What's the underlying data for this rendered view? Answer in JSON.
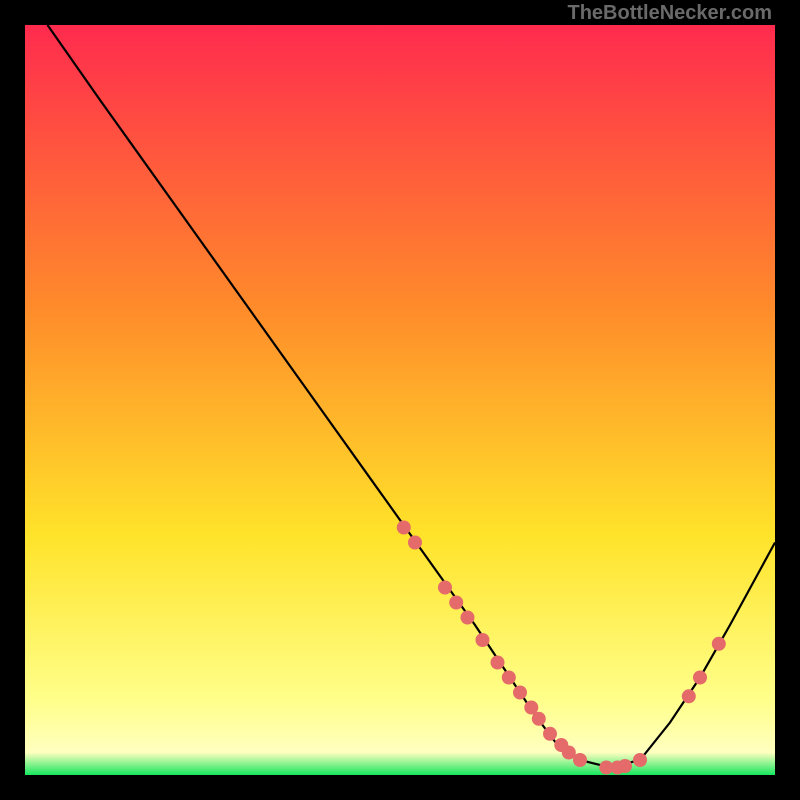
{
  "attribution": "TheBottleNecker.com",
  "colors": {
    "top": "#ff2b4e",
    "mid_orange": "#ff8c2a",
    "mid_yellow": "#ffe32a",
    "pale_yellow": "#ffff8a",
    "green": "#15e65e",
    "curve": "#000000",
    "dot": "#e56a6a",
    "frame": "#000000"
  },
  "chart_data": {
    "type": "line",
    "title": "",
    "xlabel": "",
    "ylabel": "",
    "xlim": [
      0,
      100
    ],
    "ylim": [
      0,
      100
    ],
    "curve": {
      "x": [
        3,
        10,
        20,
        30,
        40,
        50,
        55,
        60,
        64,
        68,
        71,
        74,
        78,
        82,
        86,
        90,
        94,
        100
      ],
      "y": [
        100,
        90,
        76,
        62,
        48,
        34,
        27,
        20,
        14,
        8,
        4,
        2,
        1,
        2,
        7,
        13,
        20,
        31
      ]
    },
    "highlight_dots": [
      {
        "x": 50.5,
        "y": 33
      },
      {
        "x": 52.0,
        "y": 31
      },
      {
        "x": 56.0,
        "y": 25
      },
      {
        "x": 57.5,
        "y": 23
      },
      {
        "x": 59.0,
        "y": 21
      },
      {
        "x": 61.0,
        "y": 18
      },
      {
        "x": 63.0,
        "y": 15
      },
      {
        "x": 64.5,
        "y": 13
      },
      {
        "x": 66.0,
        "y": 11
      },
      {
        "x": 67.5,
        "y": 9
      },
      {
        "x": 68.5,
        "y": 7.5
      },
      {
        "x": 70.0,
        "y": 5.5
      },
      {
        "x": 71.5,
        "y": 4
      },
      {
        "x": 72.5,
        "y": 3
      },
      {
        "x": 74.0,
        "y": 2
      },
      {
        "x": 77.5,
        "y": 1
      },
      {
        "x": 79.0,
        "y": 1
      },
      {
        "x": 80.0,
        "y": 1.2
      },
      {
        "x": 82.0,
        "y": 2
      },
      {
        "x": 88.5,
        "y": 10.5
      },
      {
        "x": 90.0,
        "y": 13
      },
      {
        "x": 92.5,
        "y": 17.5
      }
    ]
  }
}
